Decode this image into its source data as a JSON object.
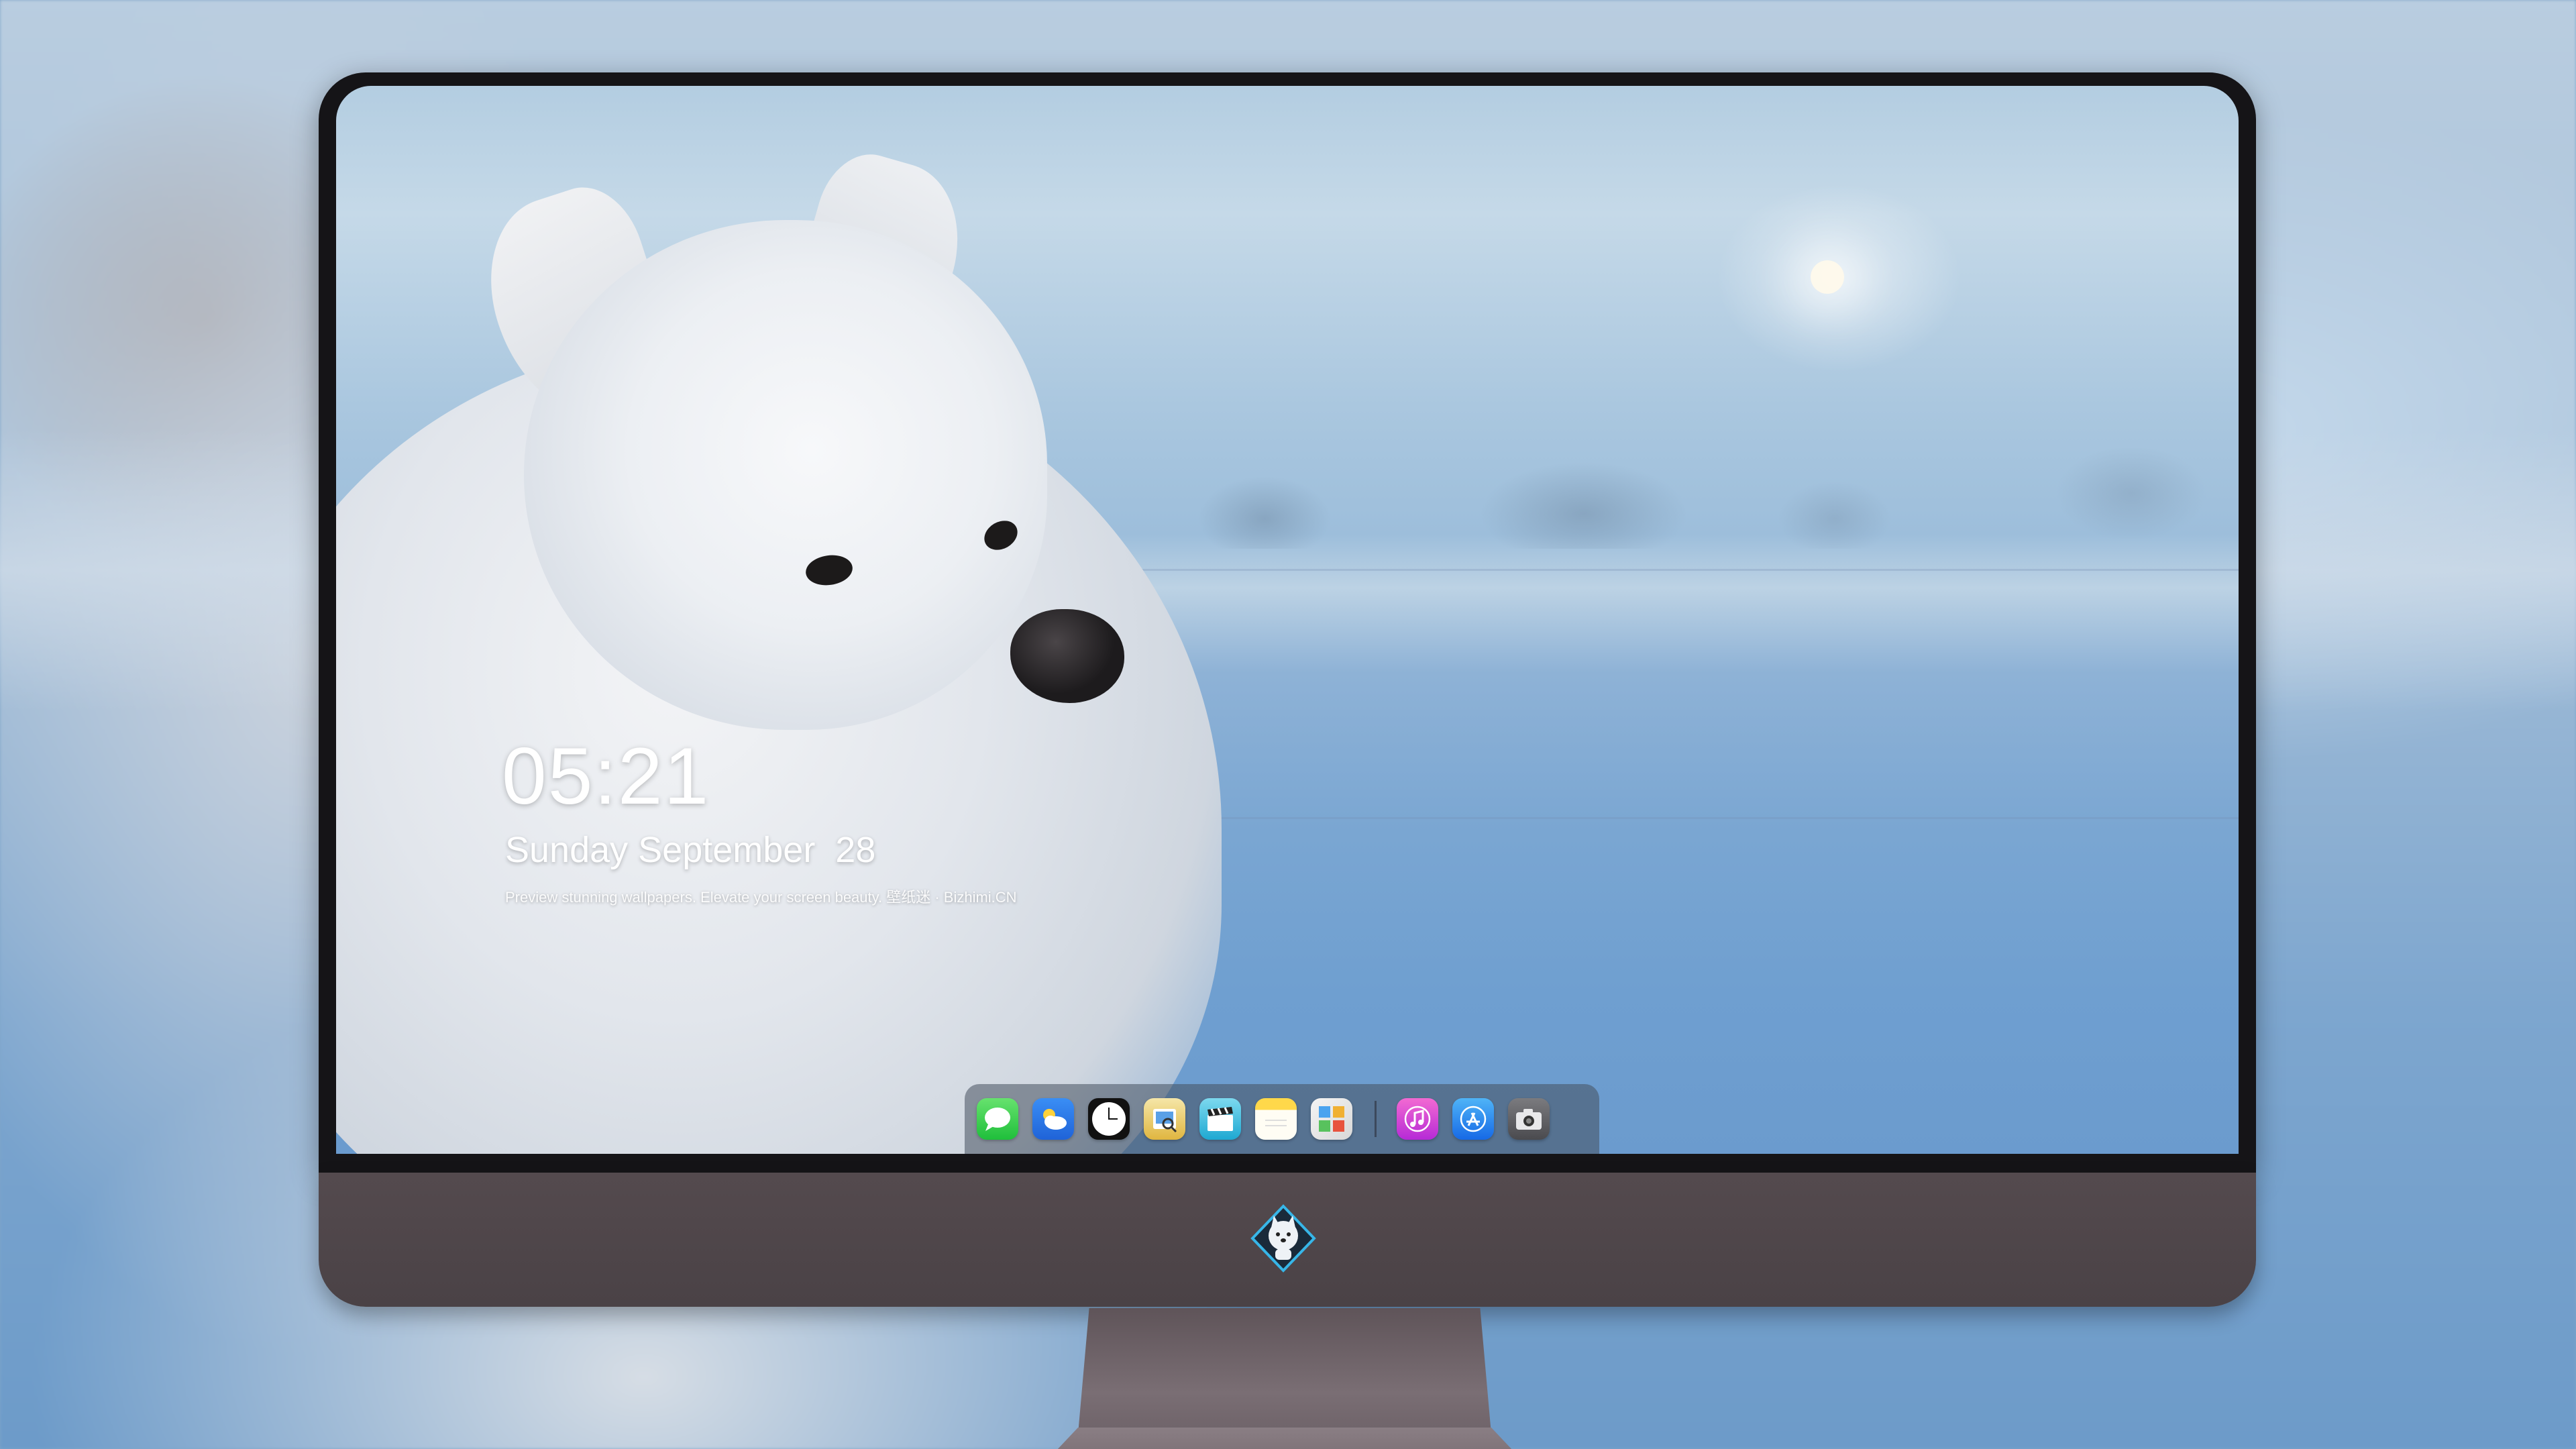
{
  "lockscreen": {
    "time": "05:21",
    "date": "Sunday September  28",
    "tagline": "Preview stunning wallpapers. Elevate your screen beauty. 壁纸迷 · Bizhimi.CN"
  },
  "dock": {
    "apps": [
      {
        "name": "Messages",
        "icon": "messages-icon"
      },
      {
        "name": "Weather",
        "icon": "weather-icon"
      },
      {
        "name": "Clock",
        "icon": "clock-icon"
      },
      {
        "name": "Preview",
        "icon": "preview-icon"
      },
      {
        "name": "Clips",
        "icon": "clapperboard-icon"
      },
      {
        "name": "Notes",
        "icon": "notes-icon"
      },
      {
        "name": "Photo Booth",
        "icon": "photos-icon"
      },
      {
        "name": "Music",
        "icon": "music-note-icon"
      },
      {
        "name": "App Store",
        "icon": "app-store-icon"
      },
      {
        "name": "Camera",
        "icon": "camera-icon"
      }
    ]
  },
  "colors": {
    "bezel": "#151417",
    "chin": "#4a4246",
    "sky": "#b3cde1",
    "snow": "#6b9bce"
  },
  "brand": {
    "logo_icon": "samoyed-mascot-logo"
  }
}
